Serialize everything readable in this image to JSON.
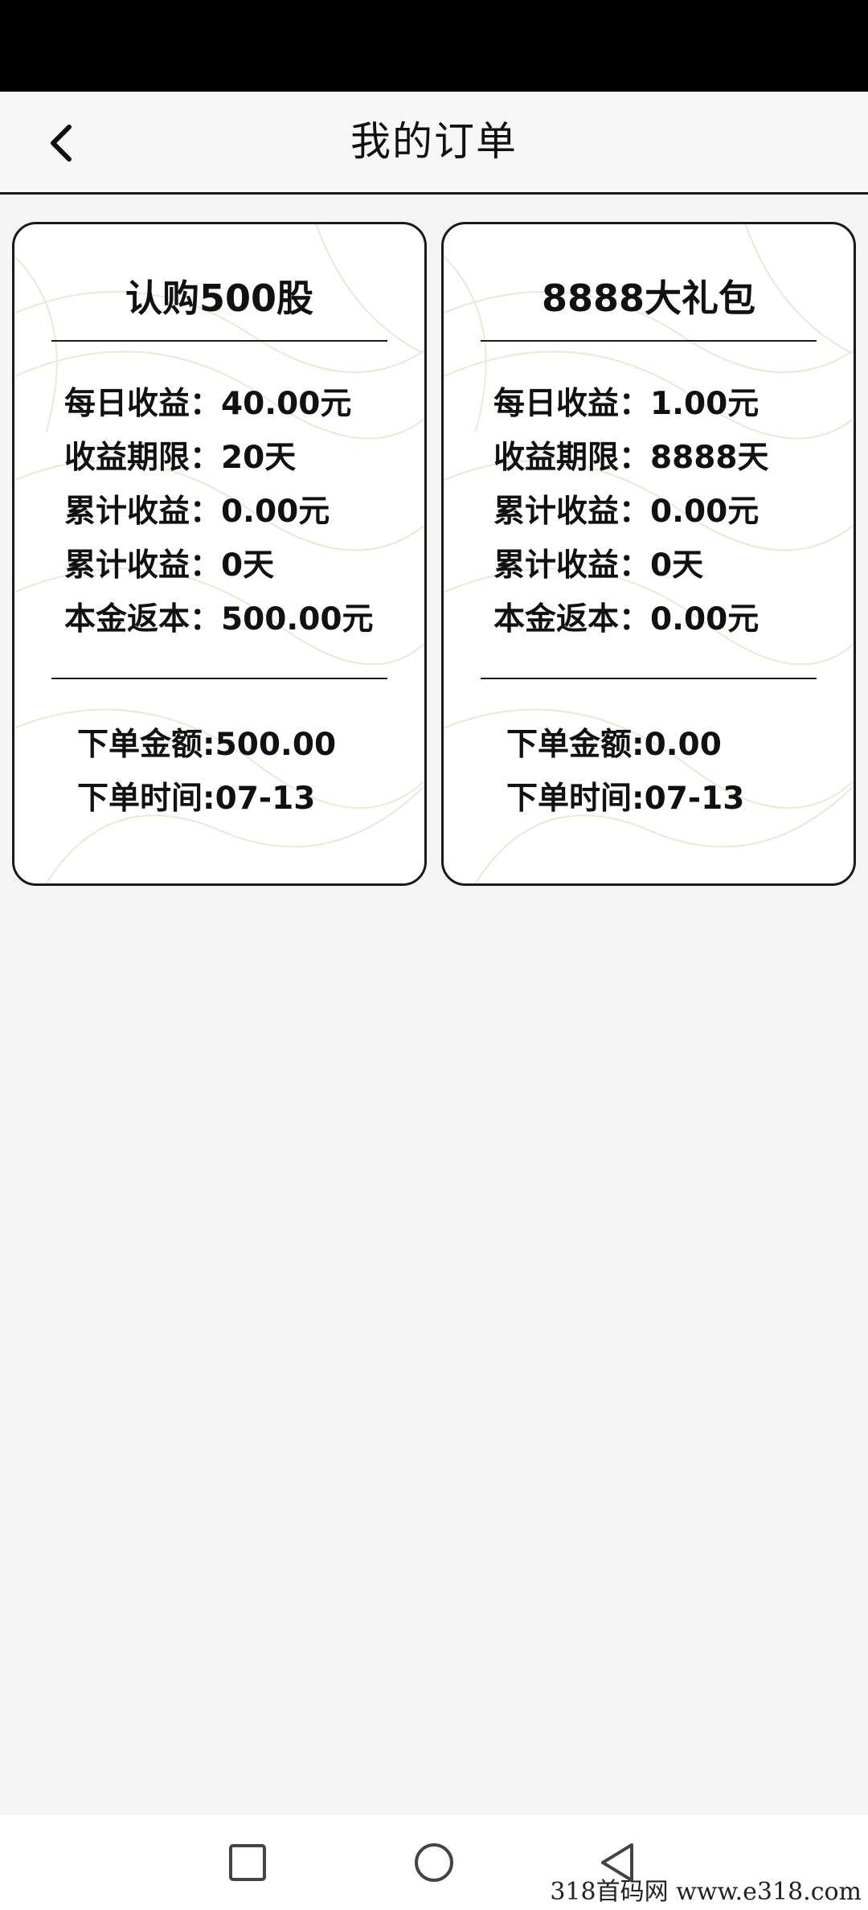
{
  "header": {
    "title": "我的订单"
  },
  "orders": [
    {
      "title": "认购500股",
      "stats": [
        {
          "label": "每日收益：",
          "value": "40.00元"
        },
        {
          "label": "收益期限：",
          "value": "20天"
        },
        {
          "label": "累计收益：",
          "value": "0.00元"
        },
        {
          "label": "累计收益：",
          "value": "0天"
        },
        {
          "label": "本金返本：",
          "value": "500.00元"
        }
      ],
      "order_amount": {
        "label": "下单金额:",
        "value": "500.00"
      },
      "order_time": {
        "label": "下单时间:",
        "value": "07-13"
      }
    },
    {
      "title": "8888大礼包",
      "stats": [
        {
          "label": "每日收益：",
          "value": "1.00元"
        },
        {
          "label": "收益期限：",
          "value": "8888天"
        },
        {
          "label": "累计收益：",
          "value": "0.00元"
        },
        {
          "label": "累计收益：",
          "value": "0天"
        },
        {
          "label": "本金返本：",
          "value": "0.00元"
        }
      ],
      "order_amount": {
        "label": "下单金额:",
        "value": "0.00"
      },
      "order_time": {
        "label": "下单时间:",
        "value": "07-13"
      }
    }
  ],
  "icons": {
    "back": "chevron-left-icon",
    "recent": "square-icon",
    "home": "circle-icon",
    "nav_back": "triangle-left-icon"
  },
  "watermark": "318首码网  www.e318.com"
}
